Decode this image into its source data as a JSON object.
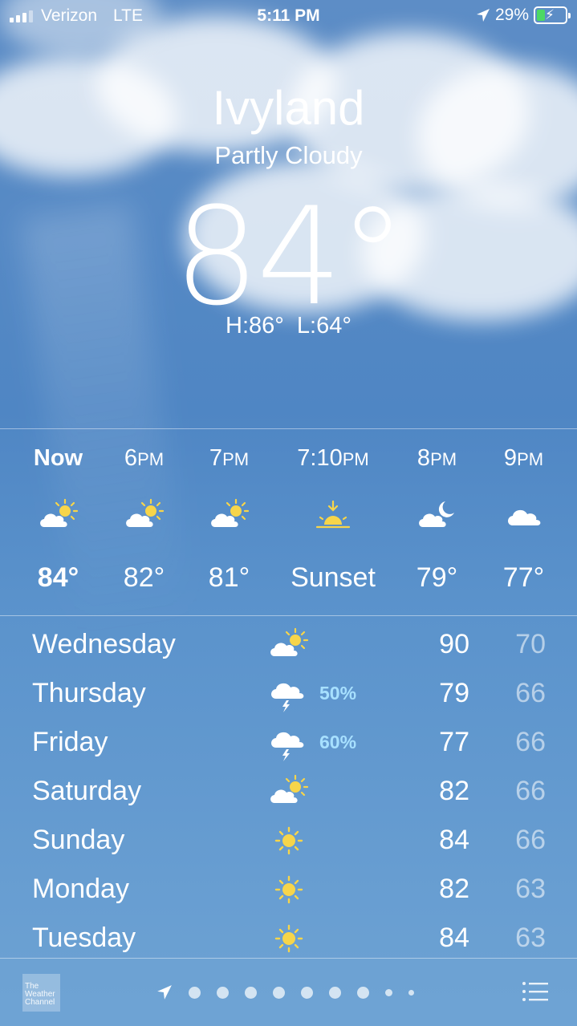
{
  "status_bar": {
    "carrier": "Verizon",
    "network": "LTE",
    "time": "5:11 PM",
    "battery": "29%"
  },
  "current": {
    "city": "Ivyland",
    "condition": "Partly Cloudy",
    "temperature": "84°",
    "hi_lo": "H:86°  L:64°"
  },
  "hourly": [
    {
      "label": "Now",
      "icon": "partly-cloudy-icon",
      "temp": "84°"
    },
    {
      "label": "6PM",
      "icon": "partly-cloudy-icon",
      "temp": "82°"
    },
    {
      "label": "7PM",
      "icon": "partly-cloudy-icon",
      "temp": "81°"
    },
    {
      "label": "7:10PM",
      "icon": "sunset-icon",
      "temp": "Sunset"
    },
    {
      "label": "8PM",
      "icon": "moon-cloud-icon",
      "temp": "79°"
    },
    {
      "label": "9PM",
      "icon": "cloud-icon",
      "temp": "77°"
    }
  ],
  "daily": [
    {
      "day": "Wednesday",
      "icon": "partly-cloudy-icon",
      "precip": "",
      "high": "90",
      "low": "70"
    },
    {
      "day": "Thursday",
      "icon": "thunderstorm-icon",
      "precip": "50%",
      "high": "79",
      "low": "66"
    },
    {
      "day": "Friday",
      "icon": "thunderstorm-icon",
      "precip": "60%",
      "high": "77",
      "low": "66"
    },
    {
      "day": "Saturday",
      "icon": "partly-cloudy-icon",
      "precip": "",
      "high": "82",
      "low": "66"
    },
    {
      "day": "Sunday",
      "icon": "sun-icon",
      "precip": "",
      "high": "84",
      "low": "66"
    },
    {
      "day": "Monday",
      "icon": "sun-icon",
      "precip": "",
      "high": "82",
      "low": "63"
    },
    {
      "day": "Tuesday",
      "icon": "sun-icon",
      "precip": "",
      "high": "84",
      "low": "63"
    }
  ],
  "bottom_bar": {
    "logo_text": "The Weather Channel",
    "page_count": 9,
    "active_page": 0
  },
  "colors": {
    "sun": "#f7d54a",
    "precip": "#a7e0ff",
    "battery": "#4cd964"
  }
}
